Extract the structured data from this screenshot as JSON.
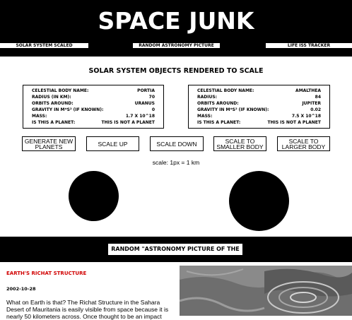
{
  "header": {
    "title": "SPACE JUNK",
    "nav": [
      {
        "label": "SOLAR SYSTEM SCALED"
      },
      {
        "label": "RANDOM ASTRONOMY PICTURE"
      },
      {
        "label": "LIFE ISS TRACKER"
      }
    ]
  },
  "solar": {
    "heading": "SOLAR SYSTEM OBJECTS RENDERED TO SCALE",
    "bodies": [
      {
        "rows": [
          {
            "label": "CELESTIAL BODY NAME:",
            "value": "PORTIA"
          },
          {
            "label": "RADIUS (IN KM):",
            "value": "70"
          },
          {
            "label": "ORBITS AROUND:",
            "value": "URANUS"
          },
          {
            "label": "GRAVITY IN M*S² (IF KNOWN):",
            "value": "0"
          },
          {
            "label": "MASS:",
            "value": "1.7 X 10^18"
          },
          {
            "label": "IS THIS A PLANET:",
            "value": "THIS IS NOT A PLANET"
          }
        ]
      },
      {
        "rows": [
          {
            "label": "CELESTIAL BODY NAME:",
            "value": "AMALTHEA"
          },
          {
            "label": "RADIUS:",
            "value": "84"
          },
          {
            "label": "ORBITS AROUND:",
            "value": "JUPITER"
          },
          {
            "label": "GRAVITY IN M*S² (IF KNOWN):",
            "value": "0.02"
          },
          {
            "label": "MASS:",
            "value": "7.5 X 10^18"
          },
          {
            "label": "IS THIS A PLANET:",
            "value": "THIS IS NOT A PLANET"
          }
        ]
      }
    ],
    "buttons": {
      "generate": "GENERATE NEW PLANETS",
      "scale_up": "SCALE UP",
      "scale_down": "SCALE DOWN",
      "smaller": "SCALE TO SMALLER BODY",
      "larger": "SCALE TO LARGER BODY"
    },
    "scale_text": "scale: 1px = 1 km"
  },
  "apod": {
    "banner": "RANDOM \"ASTRONOMY PICTURE OF THE DAY\"",
    "title": "EARTH'S RICHAT STRUCTURE",
    "date": "2002-10-28",
    "text": "What on Earth is that? The Richat Structure in the Sahara Desert of Mauritania is easily visible from space because it is nearly 50 kilometers across. Once thought to be an impact"
  }
}
